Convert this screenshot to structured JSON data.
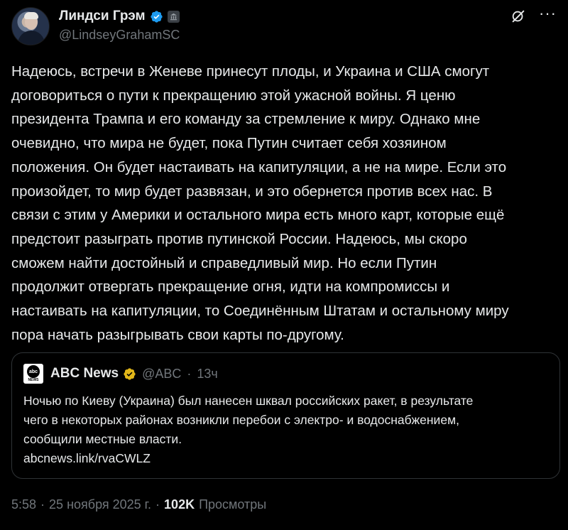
{
  "author": {
    "display_name": "Линдси Грэм",
    "handle": "@LindseyGrahamSC"
  },
  "icons": {
    "verified": "blue-verified-badge",
    "government": "government-building-badge",
    "grok": "grok-icon",
    "more": "more-icon"
  },
  "colors": {
    "background": "#000000",
    "text": "#e7e9ea",
    "muted": "#71767b",
    "verified_blue": "#1d9bf0",
    "verified_gold": "#e2b719",
    "border": "#2f3336"
  },
  "tweet": {
    "text": "Надеюсь, встречи в Женеве принесут плоды, и Украина и США смогут\nдоговориться о пути к прекращению этой ужасной войны. Я ценю\nпрезидента Трампа и его команду за стремление к миру. Однако мне\nочевидно, что мира не будет, пока Путин считает себя хозяином\nположения. Он будет настаивать на капитуляции, а не на мире. Если это\nпроизойдет, то мир будет развязан, и это обернется против всех нас. В\nсвязи с этим у Америки и остального мира есть много карт, которые ещё\nпредстоит разыграть против путинской России. Надеюсь, мы скоро\nсможем найти достойный и справедливый мир. Но если Путин\nпродолжит отвергать прекращение огня, идти на компромиссы и\nнастаивать на капитуляции, то Соединённым Штатам и остальному миру\nпора начать разыгрывать свои карты по-другому."
  },
  "quoted": {
    "name": "ABC News",
    "handle": "@ABC",
    "separator": "·",
    "time": "13ч",
    "logo_text_top": "abc",
    "logo_text_bottom": "NEWS",
    "text": "Ночью по Киеву (Украина) был нанесен шквал российских ракет, в результате\nчего в некоторых районах возникли перебои с электро- и водоснабжением,\nсообщили местные власти.\nabcnews.link/rvaCWLZ"
  },
  "footer": {
    "time": "5:58",
    "separator": "·",
    "date": "25 ноября 2025 г.",
    "separator2": "·",
    "views": "102K",
    "views_label": "Просмотры"
  }
}
